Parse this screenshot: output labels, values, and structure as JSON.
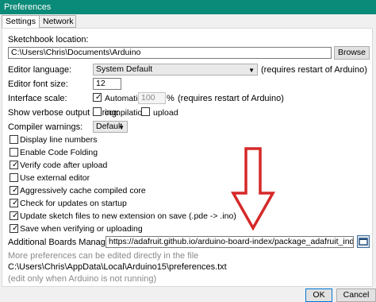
{
  "window": {
    "title": "Preferences"
  },
  "tabs": [
    {
      "label": "Settings"
    },
    {
      "label": "Network"
    }
  ],
  "sketchbook": {
    "label": "Sketchbook location:",
    "path": "C:\\Users\\Chris\\Documents\\Arduino",
    "browse_label": "Browse"
  },
  "editor_language": {
    "label": "Editor language:",
    "value": "System Default",
    "note": "(requires restart of Arduino)"
  },
  "font_size": {
    "label": "Editor font size:",
    "value": "12"
  },
  "interface_scale": {
    "label": "Interface scale:",
    "automatic_label": "Automatic",
    "automatic_checked": true,
    "value": "100",
    "percent": "%",
    "note": "(requires restart of Arduino)"
  },
  "verbose": {
    "label": "Show verbose output during:",
    "compilation_label": "compilation",
    "compilation_checked": false,
    "upload_label": "upload",
    "upload_checked": false
  },
  "compiler_warnings": {
    "label": "Compiler warnings:",
    "value": "Default"
  },
  "options": [
    {
      "label": "Display line numbers",
      "checked": false
    },
    {
      "label": "Enable Code Folding",
      "checked": false
    },
    {
      "label": "Verify code after upload",
      "checked": true
    },
    {
      "label": "Use external editor",
      "checked": false
    },
    {
      "label": "Aggressively cache compiled core",
      "checked": true
    },
    {
      "label": "Check for updates on startup",
      "checked": true
    },
    {
      "label": "Update sketch files to new extension on save (.pde -> .ino)",
      "checked": true
    },
    {
      "label": "Save when verifying or uploading",
      "checked": true
    }
  ],
  "boards_manager": {
    "label": "Additional Boards Manager URLs:",
    "value": "https://adafruit.github.io/arduino-board-index/package_adafruit_index.json"
  },
  "footer": {
    "more_prefs": "More preferences can be edited directly in the file",
    "prefs_path": "C:\\Users\\Chris\\AppData\\Local\\Arduino15\\preferences.txt",
    "edit_note": "(edit only when Arduino is not running)"
  },
  "buttons": {
    "ok_label": "OK",
    "cancel_label": "Cancel"
  },
  "annotation": {
    "arrow_color": "#d62828"
  },
  "colors": {
    "titlebar": "#0a8a78"
  }
}
